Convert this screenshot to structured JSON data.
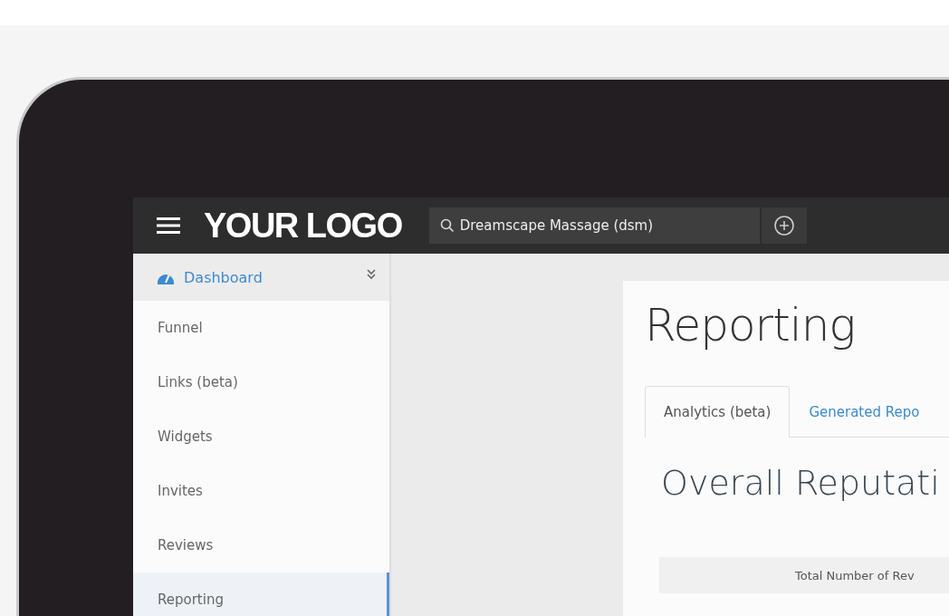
{
  "topbar": {
    "logo": "YOUR LOGO",
    "search": {
      "value": "Dreamscape Massage (dsm)"
    }
  },
  "sidebar": {
    "header": {
      "label": "Dashboard",
      "expanded": false
    },
    "items": [
      {
        "label": "Funnel",
        "selected": false
      },
      {
        "label": "Links (beta)",
        "selected": false
      },
      {
        "label": "Widgets",
        "selected": false
      },
      {
        "label": "Invites",
        "selected": false
      },
      {
        "label": "Reviews",
        "selected": false
      },
      {
        "label": "Reporting",
        "selected": true
      }
    ]
  },
  "main": {
    "title": "Reporting",
    "tabs": [
      {
        "label": "Analytics (beta)",
        "selected": true
      },
      {
        "label": "Generated Repo",
        "selected": false
      }
    ],
    "heading": "Overall Reputati",
    "table_header": "Total Number of Rev"
  }
}
